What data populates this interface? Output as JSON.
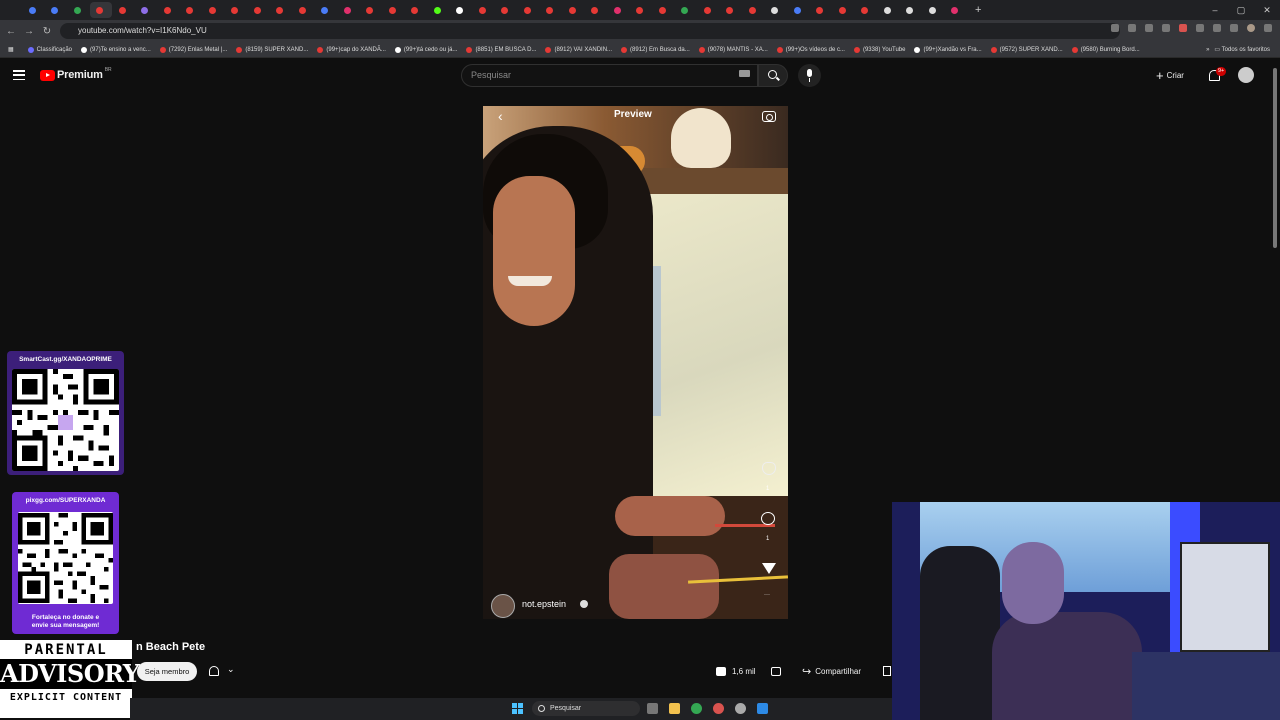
{
  "browser": {
    "url": "youtube.com/watch?v=I1K6Ndo_VU",
    "bookmarks": [
      {
        "label": "Classificação"
      },
      {
        "label": "(97)Te ensino a venc..."
      },
      {
        "label": "(7292) Enlas Metal |..."
      },
      {
        "label": "(8159) SUPER XAND..."
      },
      {
        "label": "(99+)cap do XANDÃ..."
      },
      {
        "label": "(99+)tá cedo ou já..."
      },
      {
        "label": "(8851) EM BUSCA D..."
      },
      {
        "label": "(8912) VAI XANDIN..."
      },
      {
        "label": "(8912) Em Busca da..."
      },
      {
        "label": "(9078) MANTIS - XA..."
      },
      {
        "label": "(99+)Os vídeos de c..."
      },
      {
        "label": "(9338) YouTube"
      },
      {
        "label": "(99+)Xandão vs Fra..."
      },
      {
        "label": "(9572) SUPER XAND..."
      },
      {
        "label": "(9580) Burning Bord..."
      }
    ],
    "all_bookmarks_label": "Todos os favoritos"
  },
  "youtube": {
    "logo_text": "Premium",
    "country_code": "BR",
    "search_placeholder": "Pesquisar",
    "create_label": "Criar",
    "notifications_badge": "9+"
  },
  "video_overlay": {
    "preview_title": "Preview",
    "username": "not.epstein",
    "like_count": "1",
    "comment_count": "1"
  },
  "qr_panels": {
    "top_label": "SmartCast.gg/XANDAOPRIME",
    "bottom_label": "pixgg.com/SUPERXANDA",
    "bottom_note_1": "Fortaleça no donate e",
    "bottom_note_2": "envie sua mensagem!"
  },
  "advisory": {
    "top": "PARENTAL",
    "middle": "ADVISORY",
    "bottom": "EXPLICIT CONTENT"
  },
  "video_meta": {
    "title_fragment": "n Beach Pete",
    "join_label": "Seja membro",
    "likes": "1,6 mil",
    "share_label": "Compartilhar"
  },
  "taskbar": {
    "search_label": "Pesquisar"
  },
  "colors": {
    "yt_red": "#ff0000",
    "qr_panel_top": "#3c1f7a",
    "qr_panel_bottom": "#6f2bd3",
    "windows_blue": "#4cc2ff"
  }
}
